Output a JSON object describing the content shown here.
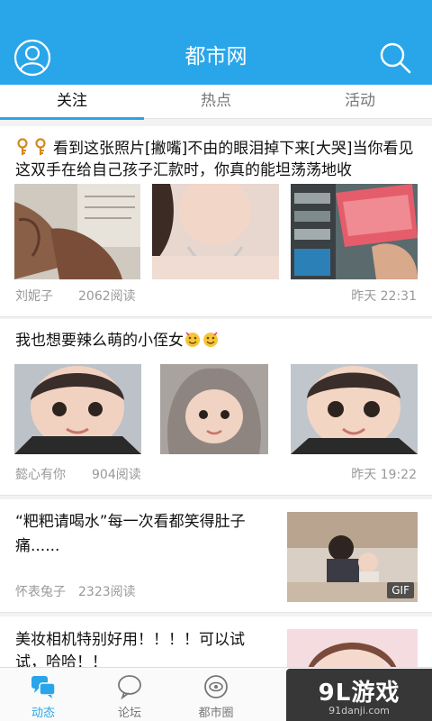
{
  "header": {
    "title": "都市网",
    "bg_color": "#29a6ea",
    "left_icon": "user-profile-icon",
    "right_icon": "search-icon"
  },
  "tabs": [
    {
      "label": "关注",
      "active": true
    },
    {
      "label": "热点",
      "active": false
    },
    {
      "label": "活动",
      "active": false
    }
  ],
  "feed": [
    {
      "title": "看到这张照片[撇嘴]不由的眼泪掉下来[大哭]当你看见这双手在给自己孩子汇款时，你真的能坦荡荡地收",
      "title_prefix_icons": [
        "key-icon",
        "key-icon"
      ],
      "author": "刘妮子",
      "reads": "2062阅读",
      "time": "昨天 22:31"
    },
    {
      "title": "我也想要辣么萌的小侄女",
      "title_suffix_icons": [
        "emoji-icon",
        "emoji-icon"
      ],
      "author": "懿心有你",
      "reads": "904阅读",
      "time": "昨天 19:22"
    },
    {
      "title": "“粑粑请喝水”每一次看都笑得肚子痛......",
      "author": "怀表兔子",
      "reads": "2323阅读",
      "badge": "GIF"
    },
    {
      "title": "美妆相机特别好用！！！！可以试试，哈哈！！"
    }
  ],
  "bottom_nav": [
    {
      "label": "动态",
      "icon": "chat-bubbles-icon",
      "active": true
    },
    {
      "label": "论坛",
      "icon": "speech-bubble-icon",
      "active": false
    },
    {
      "label": "都市圈",
      "icon": "circle-eye-icon",
      "active": false
    }
  ],
  "watermark": {
    "main": "9L游戏",
    "sub": "91danji.com"
  }
}
